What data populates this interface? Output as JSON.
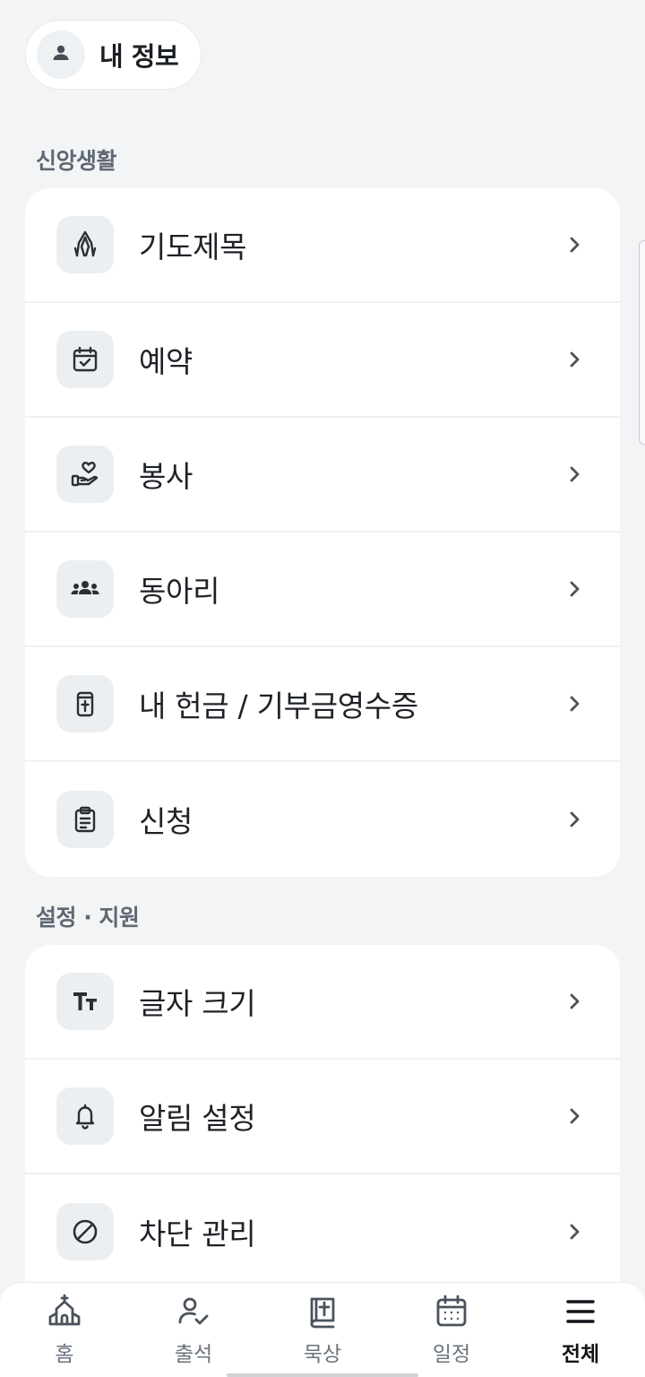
{
  "profile": {
    "label": "내 정보",
    "icon": "person-icon"
  },
  "sections": [
    {
      "title": "신앙생활",
      "items": [
        {
          "label": "기도제목",
          "icon": "praying-hands-icon"
        },
        {
          "label": "예약",
          "icon": "calendar-check-icon"
        },
        {
          "label": "봉사",
          "icon": "hand-heart-icon"
        },
        {
          "label": "동아리",
          "icon": "group-icon"
        },
        {
          "label": "내 헌금 / 기부금영수증",
          "icon": "offering-box-icon"
        },
        {
          "label": "신청",
          "icon": "clipboard-icon"
        }
      ]
    },
    {
      "title": "설정 · 지원",
      "items": [
        {
          "label": "글자 크기",
          "icon": "text-size-icon"
        },
        {
          "label": "알림 설정",
          "icon": "bell-icon"
        },
        {
          "label": "차단 관리",
          "icon": "block-icon"
        }
      ]
    }
  ],
  "bottom_nav": [
    {
      "label": "홈",
      "icon": "church-icon",
      "active": false
    },
    {
      "label": "출석",
      "icon": "user-check-icon",
      "active": false
    },
    {
      "label": "묵상",
      "icon": "bible-icon",
      "active": false
    },
    {
      "label": "일정",
      "icon": "calendar-icon",
      "active": false
    },
    {
      "label": "전체",
      "icon": "menu-icon",
      "active": true
    }
  ],
  "colors": {
    "background": "#f2f4f6",
    "card": "#ffffff",
    "icon_tile": "#eceff2",
    "text": "#1e2227",
    "muted": "#6a737d"
  }
}
